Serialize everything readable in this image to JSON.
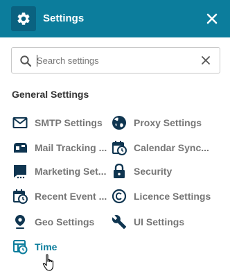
{
  "header": {
    "title": "Settings",
    "gear_icon": "gear-icon",
    "close_icon": "close-icon",
    "background": "#0c7d9c"
  },
  "search": {
    "placeholder": "Search settings",
    "value": ""
  },
  "section": {
    "title": "General Settings"
  },
  "items": [
    {
      "label": "SMTP Settings",
      "icon": "envelope-icon"
    },
    {
      "label": "Proxy Settings",
      "icon": "globe-icon"
    },
    {
      "label": "Mail Tracking ...",
      "icon": "mailbox-icon"
    },
    {
      "label": "Calendar Sync...",
      "icon": "calendar-clock-icon"
    },
    {
      "label": "Marketing Set...",
      "icon": "chat-bubble-icon"
    },
    {
      "label": "Security",
      "icon": "lock-icon"
    },
    {
      "label": "Recent Event ...",
      "icon": "calendar-clock-icon"
    },
    {
      "label": "Licence Settings",
      "icon": "copyright-icon"
    },
    {
      "label": "Geo Settings",
      "icon": "location-pin-icon"
    },
    {
      "label": "UI Settings",
      "icon": "wrench-icon"
    },
    {
      "label": "Time",
      "icon": "time-table-icon",
      "active": true
    }
  ],
  "colors": {
    "accent": "#0c7d9c",
    "icon_dark": "#0f3550",
    "label_gray": "#767676"
  }
}
